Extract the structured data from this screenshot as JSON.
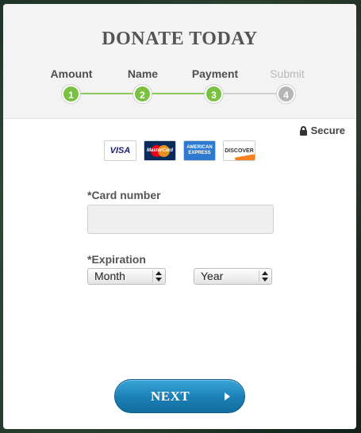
{
  "header": {
    "title": "DONATE TODAY"
  },
  "steps": [
    {
      "label": "Amount",
      "number": "1",
      "state": "complete"
    },
    {
      "label": "Name",
      "number": "2",
      "state": "complete"
    },
    {
      "label": "Payment",
      "number": "3",
      "state": "active"
    },
    {
      "label": "Submit",
      "number": "4",
      "state": "inactive"
    }
  ],
  "secure": {
    "label": "Secure",
    "icon": "lock-icon"
  },
  "cards": [
    {
      "name": "VISA",
      "icon": "visa-icon"
    },
    {
      "name": "MasterCard",
      "icon": "mastercard-icon"
    },
    {
      "name": "AMERICAN EXPRESS",
      "icon": "amex-icon"
    },
    {
      "name": "DISCOVER",
      "icon": "discover-icon"
    }
  ],
  "form": {
    "card_number_label": "*Card number",
    "card_number_value": "",
    "expiration_label": "*Expiration",
    "month_value": "Month",
    "year_value": "Year"
  },
  "next_button": {
    "label": "NEXT"
  },
  "colors": {
    "step_complete": "#7ac143",
    "step_inactive": "#b5b5b5",
    "button_blue": "#1b7fb5"
  }
}
